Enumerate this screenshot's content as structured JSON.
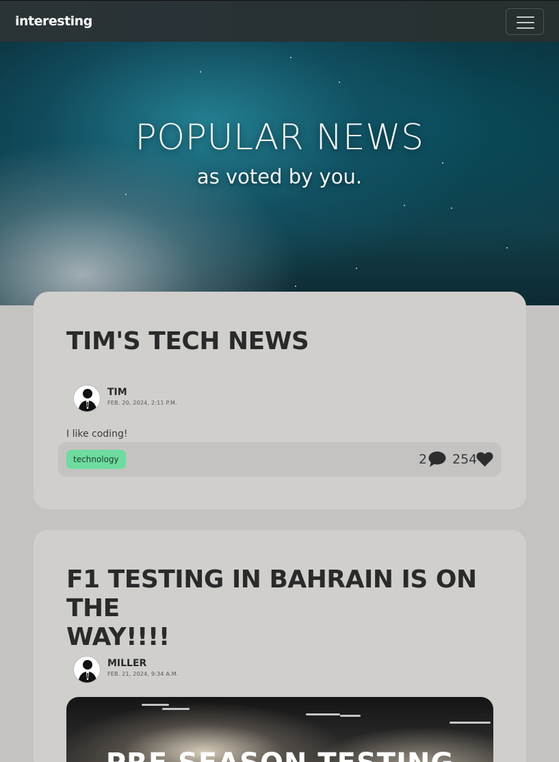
{
  "navbar": {
    "brand": "interesting"
  },
  "hero": {
    "title": "POPULAR NEWS",
    "subtitle": "as voted by you."
  },
  "posts": [
    {
      "title": "TIM'S TECH NEWS",
      "author": "TIM",
      "date": "FEB. 20, 2024, 2:11 P.M.",
      "excerpt": "I like coding!",
      "tag": "technology",
      "comments": "2",
      "likes": "254"
    },
    {
      "title_line1": "F1 TESTING IN BAHRAIN IS ON THE",
      "title_line2": "WAY!!!!",
      "author": "MILLER",
      "date": "FEB. 21, 2024, 9:34 A.M.",
      "image_text": "PRE SEASON TESTING"
    }
  ],
  "icons": {
    "menu": "hamburger-icon",
    "comment": "comment-icon",
    "like": "heart-icon",
    "avatar": "user-silhouette-icon"
  },
  "colors": {
    "tag_bg": "#6ddc9e",
    "card_bg": "#d0cfcc",
    "page_bg": "#c4c3c2"
  }
}
